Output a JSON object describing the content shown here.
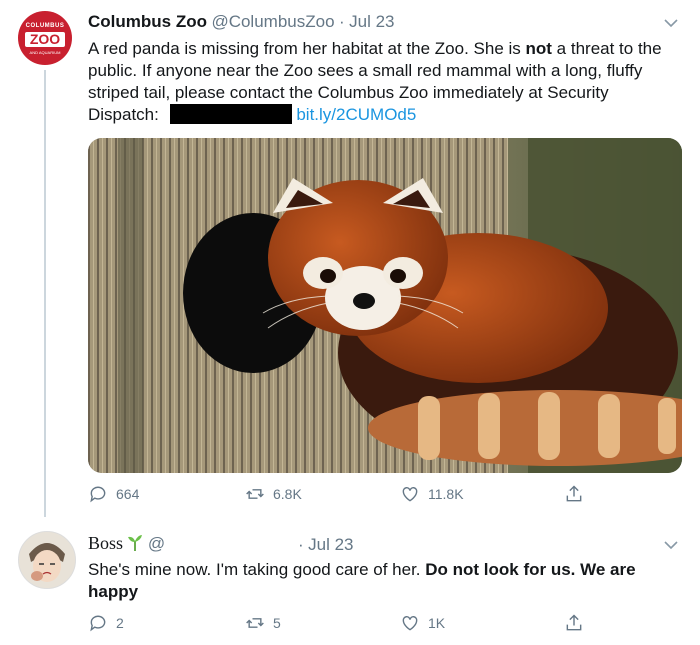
{
  "tweet1": {
    "avatar": {
      "top_text": "COLUMBUS",
      "main_text": "ZOO",
      "subtext": "AND AQUARIUM"
    },
    "name": "Columbus Zoo",
    "handle": "@ColumbusZoo",
    "sep": "·",
    "date": "Jul 23",
    "text_part1": "A red panda is missing from her habitat at the Zoo. She is ",
    "text_bold": "not",
    "text_part2": " a threat to the public. If anyone near the Zoo sees a small red mammal with a long, fluffy striped tail, please contact the Columbus Zoo immediately at Security Dispatch:",
    "link": "bit.ly/2CUMOd5",
    "actions": {
      "replies": "664",
      "retweets": "6.8K",
      "likes": "11.8K"
    }
  },
  "tweet2": {
    "name": "Boss",
    "handle": "@",
    "sep": "·",
    "date": "Jul 23",
    "text_part1": "She's mine now. I'm taking good care of her. ",
    "text_bold": "Do not look for us. We are happy",
    "actions": {
      "replies": "2",
      "retweets": "5",
      "likes": "1K"
    }
  },
  "icons": {
    "reply": "reply-icon",
    "retweet": "retweet-icon",
    "like": "heart-icon",
    "share": "share-icon",
    "menu": "chevron-down-icon",
    "sprout": "sprout-icon"
  },
  "colors": {
    "link": "#1b95e0",
    "muted": "#657786",
    "zoo_red": "#c8202f"
  }
}
